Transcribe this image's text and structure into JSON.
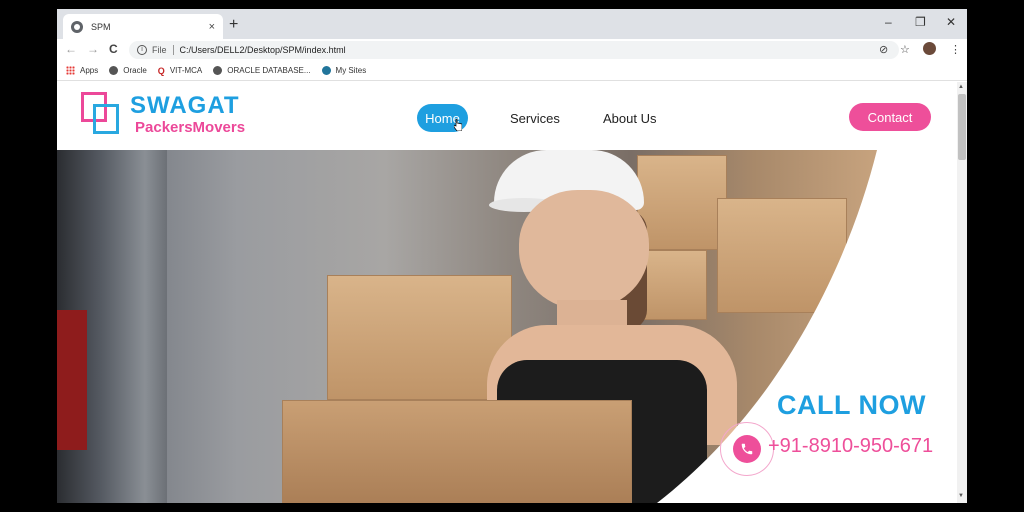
{
  "browser": {
    "tab_title": "SPM",
    "tab_close": "×",
    "new_tab": "+",
    "url_scheme": "File",
    "url": "C:/Users/DELL2/Desktop/SPM/index.html",
    "controls": {
      "minimize": "–",
      "maximize": "❐",
      "close": "✕"
    },
    "nav": {
      "back": "←",
      "forward": "→",
      "reload": "C"
    },
    "toolbar_icons": {
      "eye_off": "⊘",
      "star": "☆",
      "menu": "⋮"
    }
  },
  "bookmarks": [
    {
      "label": "Apps",
      "icon": "apps-grid-icon"
    },
    {
      "label": "Oracle",
      "icon": "globe-icon"
    },
    {
      "label": "VIT-MCA",
      "icon": "q-icon"
    },
    {
      "label": "ORACLE DATABASE...",
      "icon": "globe-icon"
    },
    {
      "label": "My Sites",
      "icon": "wordpress-icon"
    }
  ],
  "site": {
    "brand_line1": "SWAGAT",
    "brand_line2": "PackersMovers",
    "nav": {
      "home": "Home",
      "services": "Services",
      "about": "About Us"
    },
    "contact": "Contact",
    "hero": {
      "call_now": "CALL NOW",
      "phone": "+91-8910-950-671"
    }
  },
  "colors": {
    "brand_blue": "#1e9fe0",
    "brand_pink": "#ee4f9a"
  }
}
